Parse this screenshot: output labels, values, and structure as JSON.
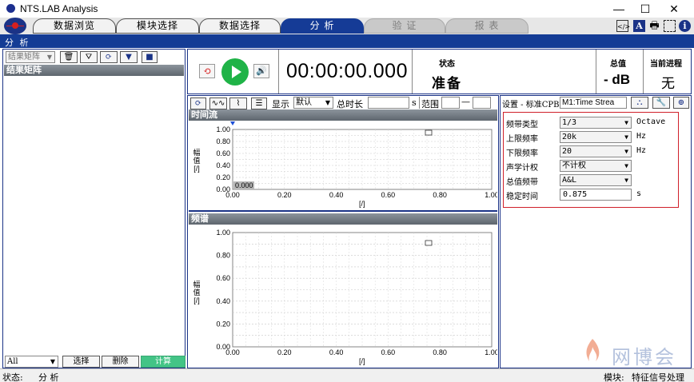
{
  "window": {
    "title": "NTS.LAB Analysis",
    "controls": [
      "—",
      "☐",
      "✕"
    ]
  },
  "tabs": [
    {
      "label": "数据浏览",
      "state": "normal"
    },
    {
      "label": "模块选择",
      "state": "normal"
    },
    {
      "label": "数据选择",
      "state": "normal"
    },
    {
      "label": "分 析",
      "state": "active"
    },
    {
      "label": "验 证",
      "state": "disabled"
    },
    {
      "label": "报 表",
      "state": "disabled"
    }
  ],
  "section": {
    "label": "分 析"
  },
  "left_panel": {
    "toolbar_select": "结果矩阵",
    "header": "结果矩阵",
    "bottom_select": "All",
    "buttons": {
      "select": "选择",
      "delete": "删除",
      "compute": "计算"
    }
  },
  "transport": {
    "timer": "00:00:00.000",
    "status_label": "状态",
    "status_value": "准备",
    "total_label": "总值",
    "total_value": "- dB",
    "progress_label": "当前进程",
    "progress_value": "无"
  },
  "plot_toolbar": {
    "display_label": "显示",
    "display_value": "默认",
    "duration_label": "总时长",
    "duration_unit": "s",
    "range_label": "范围",
    "range_sep": "—"
  },
  "time_plot": {
    "header": "时间流",
    "ylabel": "幅值 [/]",
    "xlabel": "[/]",
    "readout": "0.000",
    "chart_data": {
      "type": "line",
      "x_ticks": [
        "0.00",
        "0.20",
        "0.40",
        "0.60",
        "0.80",
        "1.00"
      ],
      "y_ticks": [
        "0.00",
        "0.20",
        "0.40",
        "0.60",
        "0.80",
        "1.00"
      ],
      "xlim": [
        0,
        1
      ],
      "ylim": [
        0,
        1
      ],
      "series": [],
      "grid": true,
      "legend": "top-right"
    }
  },
  "spectrum_plot": {
    "header": "频谱",
    "ylabel": "幅值 [/]",
    "xlabel": "[/]",
    "chart_data": {
      "type": "line",
      "x_ticks": [
        "0.00",
        "0.20",
        "0.40",
        "0.60",
        "0.80",
        "1.00"
      ],
      "y_ticks": [
        "0.00",
        "0.20",
        "0.40",
        "0.60",
        "0.80",
        "1.00"
      ],
      "xlim": [
        0,
        1
      ],
      "ylim": [
        0,
        1
      ],
      "series": [],
      "grid": true,
      "legend": "top-right"
    }
  },
  "settings": {
    "title": "设置 - 标准CPB",
    "selector": "M1:Time Strea",
    "rows": [
      {
        "label": "频带类型",
        "value": "1/3",
        "type": "select",
        "unit": "Octave"
      },
      {
        "label": "上限频率",
        "value": "20k",
        "type": "select",
        "unit": "Hz"
      },
      {
        "label": "下限频率",
        "value": "20",
        "type": "select",
        "unit": "Hz"
      },
      {
        "label": "声学计权",
        "value": "不计权",
        "type": "select",
        "unit": ""
      },
      {
        "label": "总值频带",
        "value": "A&L",
        "type": "select",
        "unit": ""
      },
      {
        "label": "稳定时间",
        "value": "0.875",
        "type": "input",
        "unit": "s"
      }
    ]
  },
  "statusbar": {
    "status_label": "状态:",
    "status_value": "分 析",
    "module_label": "模块:",
    "module_value": "特征信号处理"
  },
  "watermark": {
    "text": "网博会"
  },
  "colors": {
    "accent": "#153b96",
    "play": "#1fb347",
    "compute": "#43c486",
    "highlight": "#d0202a"
  }
}
